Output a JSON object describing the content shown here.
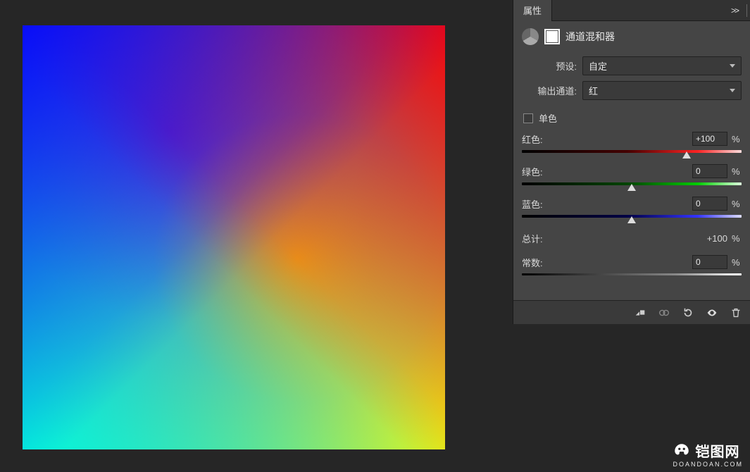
{
  "panel": {
    "tab": "属性",
    "title": "通道混和器",
    "preset_label": "预设:",
    "preset_value": "自定",
    "output_label": "输出通道:",
    "output_value": "红",
    "mono_label": "单色",
    "sliders": {
      "red": {
        "label": "红色:",
        "value": "+100",
        "unit": "%",
        "pos": 75
      },
      "green": {
        "label": "绿色:",
        "value": "0",
        "unit": "%",
        "pos": 50
      },
      "blue": {
        "label": "蓝色:",
        "value": "0",
        "unit": "%",
        "pos": 50
      }
    },
    "total": {
      "label": "总计:",
      "value": "+100",
      "unit": "%"
    },
    "constant": {
      "label": "常数:",
      "value": "0",
      "unit": "%",
      "pos": 50
    }
  },
  "watermark": {
    "title": "铠图网",
    "sub": "DOANDOAN.COM"
  }
}
